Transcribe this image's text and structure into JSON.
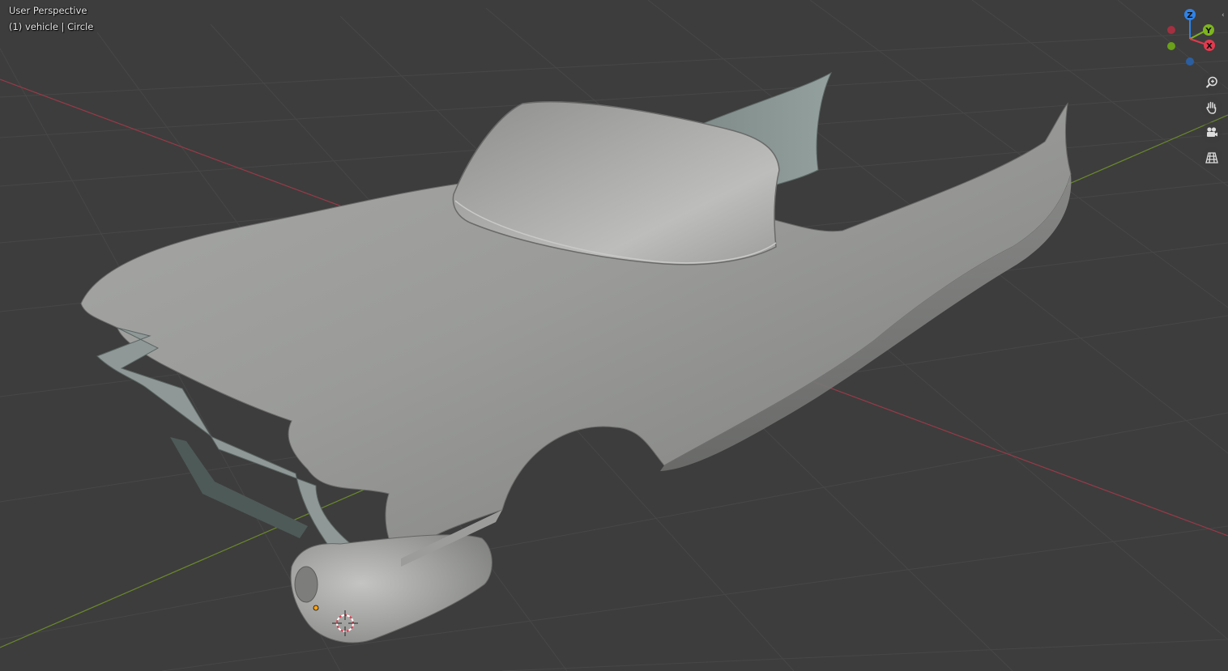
{
  "viewport": {
    "view_name": "User Perspective",
    "object_info": "(1) vehicle | Circle"
  },
  "gizmo": {
    "axes": [
      {
        "label": "Z",
        "color": "#2f83e6"
      },
      {
        "label": "Y",
        "color": "#7db51e"
      },
      {
        "label": "X",
        "color": "#e23a4e"
      }
    ],
    "negative_colors": {
      "x": "#a33040",
      "y": "#6aa01a",
      "z": "#2a5e9f"
    }
  },
  "nav_tools": [
    {
      "name": "zoom-icon"
    },
    {
      "name": "hand-pan-icon"
    },
    {
      "name": "camera-icon"
    },
    {
      "name": "grid-perspective-icon"
    }
  ],
  "colors": {
    "background": "#3d3d3d",
    "grid": "#474747",
    "x_axis": "#9a3a48",
    "y_axis": "#6b8a2a",
    "model": "#9a9b99"
  }
}
